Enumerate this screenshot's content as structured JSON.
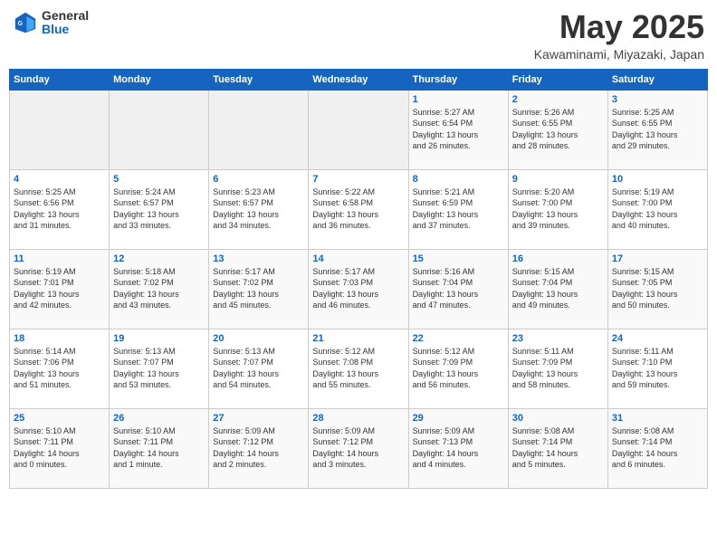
{
  "header": {
    "logo_general": "General",
    "logo_blue": "Blue",
    "title": "May 2025",
    "subtitle": "Kawaminami, Miyazaki, Japan"
  },
  "days_of_week": [
    "Sunday",
    "Monday",
    "Tuesday",
    "Wednesday",
    "Thursday",
    "Friday",
    "Saturday"
  ],
  "weeks": [
    [
      {
        "day": "",
        "info": ""
      },
      {
        "day": "",
        "info": ""
      },
      {
        "day": "",
        "info": ""
      },
      {
        "day": "",
        "info": ""
      },
      {
        "day": "1",
        "info": "Sunrise: 5:27 AM\nSunset: 6:54 PM\nDaylight: 13 hours\nand 26 minutes."
      },
      {
        "day": "2",
        "info": "Sunrise: 5:26 AM\nSunset: 6:55 PM\nDaylight: 13 hours\nand 28 minutes."
      },
      {
        "day": "3",
        "info": "Sunrise: 5:25 AM\nSunset: 6:55 PM\nDaylight: 13 hours\nand 29 minutes."
      }
    ],
    [
      {
        "day": "4",
        "info": "Sunrise: 5:25 AM\nSunset: 6:56 PM\nDaylight: 13 hours\nand 31 minutes."
      },
      {
        "day": "5",
        "info": "Sunrise: 5:24 AM\nSunset: 6:57 PM\nDaylight: 13 hours\nand 33 minutes."
      },
      {
        "day": "6",
        "info": "Sunrise: 5:23 AM\nSunset: 6:57 PM\nDaylight: 13 hours\nand 34 minutes."
      },
      {
        "day": "7",
        "info": "Sunrise: 5:22 AM\nSunset: 6:58 PM\nDaylight: 13 hours\nand 36 minutes."
      },
      {
        "day": "8",
        "info": "Sunrise: 5:21 AM\nSunset: 6:59 PM\nDaylight: 13 hours\nand 37 minutes."
      },
      {
        "day": "9",
        "info": "Sunrise: 5:20 AM\nSunset: 7:00 PM\nDaylight: 13 hours\nand 39 minutes."
      },
      {
        "day": "10",
        "info": "Sunrise: 5:19 AM\nSunset: 7:00 PM\nDaylight: 13 hours\nand 40 minutes."
      }
    ],
    [
      {
        "day": "11",
        "info": "Sunrise: 5:19 AM\nSunset: 7:01 PM\nDaylight: 13 hours\nand 42 minutes."
      },
      {
        "day": "12",
        "info": "Sunrise: 5:18 AM\nSunset: 7:02 PM\nDaylight: 13 hours\nand 43 minutes."
      },
      {
        "day": "13",
        "info": "Sunrise: 5:17 AM\nSunset: 7:02 PM\nDaylight: 13 hours\nand 45 minutes."
      },
      {
        "day": "14",
        "info": "Sunrise: 5:17 AM\nSunset: 7:03 PM\nDaylight: 13 hours\nand 46 minutes."
      },
      {
        "day": "15",
        "info": "Sunrise: 5:16 AM\nSunset: 7:04 PM\nDaylight: 13 hours\nand 47 minutes."
      },
      {
        "day": "16",
        "info": "Sunrise: 5:15 AM\nSunset: 7:04 PM\nDaylight: 13 hours\nand 49 minutes."
      },
      {
        "day": "17",
        "info": "Sunrise: 5:15 AM\nSunset: 7:05 PM\nDaylight: 13 hours\nand 50 minutes."
      }
    ],
    [
      {
        "day": "18",
        "info": "Sunrise: 5:14 AM\nSunset: 7:06 PM\nDaylight: 13 hours\nand 51 minutes."
      },
      {
        "day": "19",
        "info": "Sunrise: 5:13 AM\nSunset: 7:07 PM\nDaylight: 13 hours\nand 53 minutes."
      },
      {
        "day": "20",
        "info": "Sunrise: 5:13 AM\nSunset: 7:07 PM\nDaylight: 13 hours\nand 54 minutes."
      },
      {
        "day": "21",
        "info": "Sunrise: 5:12 AM\nSunset: 7:08 PM\nDaylight: 13 hours\nand 55 minutes."
      },
      {
        "day": "22",
        "info": "Sunrise: 5:12 AM\nSunset: 7:09 PM\nDaylight: 13 hours\nand 56 minutes."
      },
      {
        "day": "23",
        "info": "Sunrise: 5:11 AM\nSunset: 7:09 PM\nDaylight: 13 hours\nand 58 minutes."
      },
      {
        "day": "24",
        "info": "Sunrise: 5:11 AM\nSunset: 7:10 PM\nDaylight: 13 hours\nand 59 minutes."
      }
    ],
    [
      {
        "day": "25",
        "info": "Sunrise: 5:10 AM\nSunset: 7:11 PM\nDaylight: 14 hours\nand 0 minutes."
      },
      {
        "day": "26",
        "info": "Sunrise: 5:10 AM\nSunset: 7:11 PM\nDaylight: 14 hours\nand 1 minute."
      },
      {
        "day": "27",
        "info": "Sunrise: 5:09 AM\nSunset: 7:12 PM\nDaylight: 14 hours\nand 2 minutes."
      },
      {
        "day": "28",
        "info": "Sunrise: 5:09 AM\nSunset: 7:12 PM\nDaylight: 14 hours\nand 3 minutes."
      },
      {
        "day": "29",
        "info": "Sunrise: 5:09 AM\nSunset: 7:13 PM\nDaylight: 14 hours\nand 4 minutes."
      },
      {
        "day": "30",
        "info": "Sunrise: 5:08 AM\nSunset: 7:14 PM\nDaylight: 14 hours\nand 5 minutes."
      },
      {
        "day": "31",
        "info": "Sunrise: 5:08 AM\nSunset: 7:14 PM\nDaylight: 14 hours\nand 6 minutes."
      }
    ]
  ]
}
